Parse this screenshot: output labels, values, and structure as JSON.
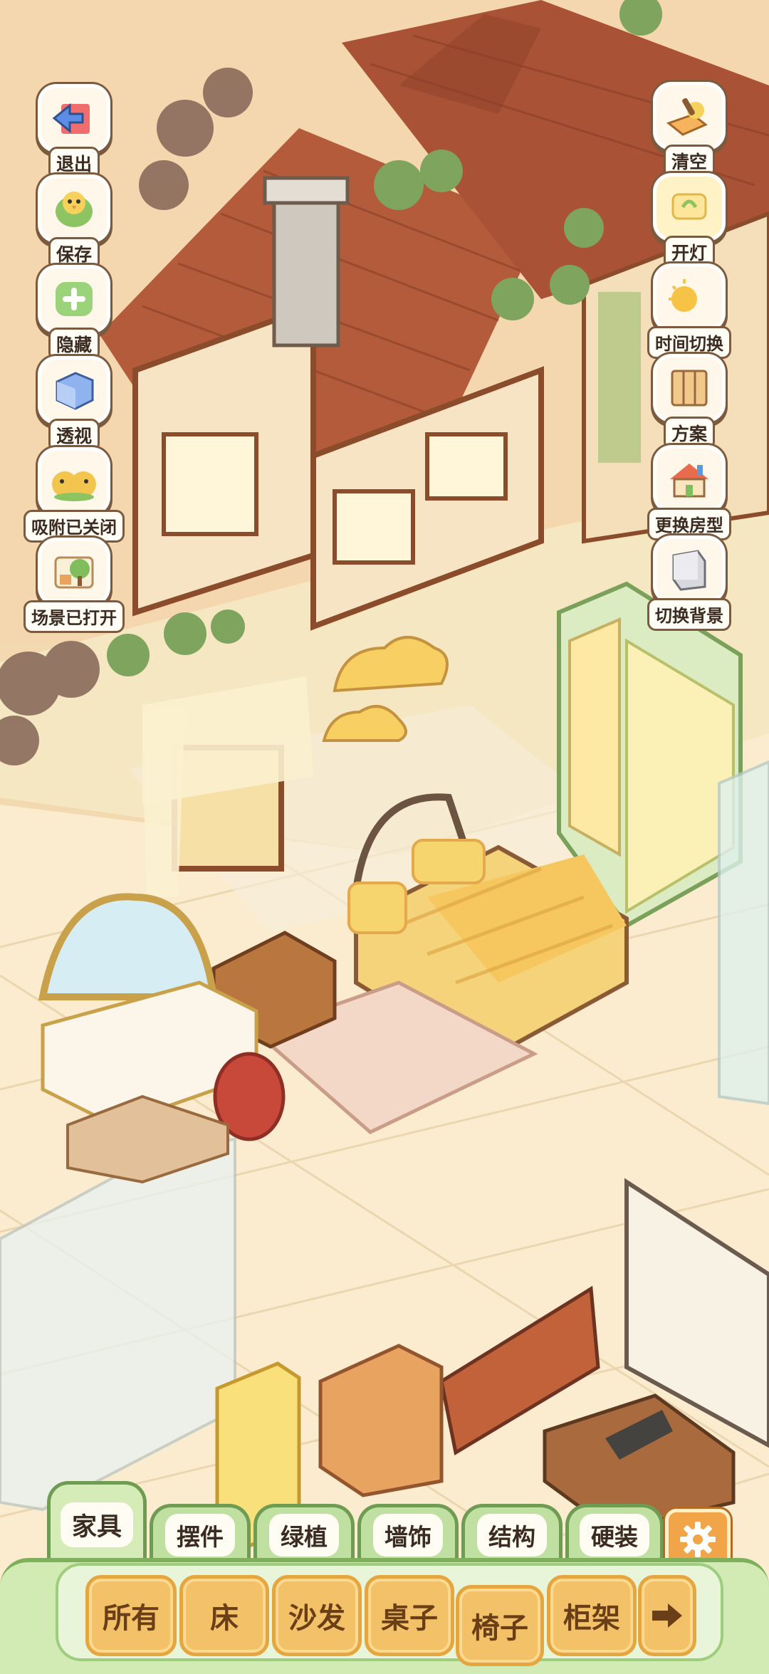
{
  "left_tools": [
    {
      "label": "退出",
      "icon": "exit-icon"
    },
    {
      "label": "保存",
      "icon": "save-icon"
    },
    {
      "label": "隐藏",
      "icon": "hide-icon"
    },
    {
      "label": "透视",
      "icon": "perspective-icon"
    },
    {
      "label": "吸附已关闭",
      "icon": "snap-icon"
    },
    {
      "label": "场景已打开",
      "icon": "scene-icon"
    }
  ],
  "right_tools": [
    {
      "label": "清空",
      "icon": "clear-icon"
    },
    {
      "label": "开灯",
      "icon": "light-icon"
    },
    {
      "label": "时间切换",
      "icon": "time-switch-icon"
    },
    {
      "label": "方案",
      "icon": "plan-icon"
    },
    {
      "label": "更换房型",
      "icon": "house-type-icon"
    },
    {
      "label": "切换背景",
      "icon": "background-icon"
    }
  ],
  "categories": [
    "家具",
    "摆件",
    "绿植",
    "墙饰",
    "结构",
    "硬装"
  ],
  "active_category": "家具",
  "subcategories": [
    "所有",
    "床",
    "沙发",
    "桌子",
    "椅子",
    "柜架"
  ],
  "selected_subcategory": "椅子",
  "colors": {
    "tab_green": "#bfe0a0",
    "panel_green": "#d2ebb4",
    "sub_orange": "#f3c168",
    "gear": "#f2a548"
  }
}
